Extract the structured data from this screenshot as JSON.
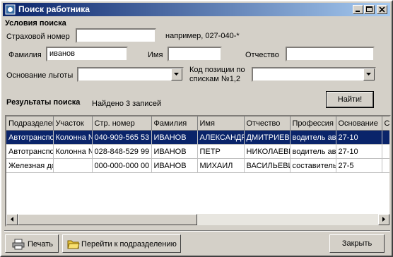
{
  "window": {
    "title": "Поиск работника"
  },
  "conditions": {
    "heading": "Условия поиска",
    "insurance_label": "Страховой номер",
    "insurance_value": "",
    "insurance_hint": "например, 027-040-*",
    "surname_label": "Фамилия",
    "surname_value": "иванов",
    "name_label": "Имя",
    "name_value": "",
    "patronymic_label": "Отчество",
    "patronymic_value": "",
    "benefit_label": "Основание льготы",
    "benefit_value": "",
    "position_code_label_1": "Код позиции по",
    "position_code_label_2": "спискам №1,2",
    "position_code_value": "",
    "find_button": "Найти!"
  },
  "results": {
    "heading": "Результаты поиска",
    "count_text": "Найдено 3 записей",
    "columns": [
      "Подразделение",
      "Участок",
      "Стр. номер",
      "Фамилия",
      "Имя",
      "Отчество",
      "Профессия",
      "Основание",
      "Сп"
    ],
    "rows": [
      [
        "Автотранспортный цех",
        "Колонна №",
        "040-909-565 53",
        "ИВАНОВ",
        "АЛЕКСАНДР",
        "ДМИТРИЕВИЧ",
        "водитель авто",
        "27-10",
        ""
      ],
      [
        "Автотранспортный цех",
        "Колонна №",
        "028-848-529 99",
        "ИВАНОВ",
        "ПЕТР",
        "НИКОЛАЕВИЧ",
        "водитель авто",
        "27-10",
        ""
      ],
      [
        "Железная дорога",
        "",
        "000-000-000 00",
        "ИВАНОВ",
        "МИХАИЛ",
        "ВАСИЛЬЕВИЧ",
        "составитель",
        "27-5",
        ""
      ]
    ],
    "selected_row": 0
  },
  "footer": {
    "print_button": "Печать",
    "goto_button": "Перейти к подразделению",
    "close_button": "Закрыть"
  },
  "icons": {
    "app": "app-icon",
    "minimize": "minimize-icon",
    "maximize": "maximize-icon",
    "close": "close-icon",
    "printer": "printer-icon",
    "folder": "folder-icon"
  },
  "colors": {
    "title_start": "#0a246a",
    "title_end": "#a6caf0",
    "selection": "#0a246a",
    "face": "#d4d0c8"
  }
}
